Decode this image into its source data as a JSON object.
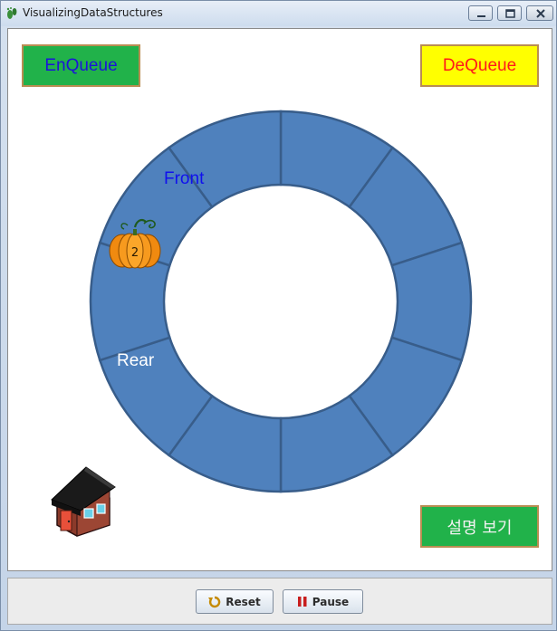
{
  "window": {
    "title": "VisualizingDataStructures"
  },
  "buttons": {
    "enqueue": "EnQueue",
    "dequeue": "DeQueue",
    "explain": "설명 보기"
  },
  "ring": {
    "front_label": "Front",
    "rear_label": "Rear",
    "segments": 10,
    "fill_color": "#4f81bd",
    "stroke_color": "#385d8a"
  },
  "queue": {
    "items": [
      {
        "icon": "pumpkin-icon",
        "label": "2"
      }
    ]
  },
  "scene": {
    "house_icon": "house-icon"
  },
  "controls": {
    "reset_label": "Reset",
    "pause_label": "Pause"
  },
  "colors": {
    "enqueue_bg": "#21b24a",
    "enqueue_text": "#1c14d8",
    "dequeue_bg": "#ffff00",
    "dequeue_text": "#ff1a1a",
    "explain_bg": "#21b24a",
    "front_text": "#1010ee",
    "rear_text": "#ffffff"
  }
}
